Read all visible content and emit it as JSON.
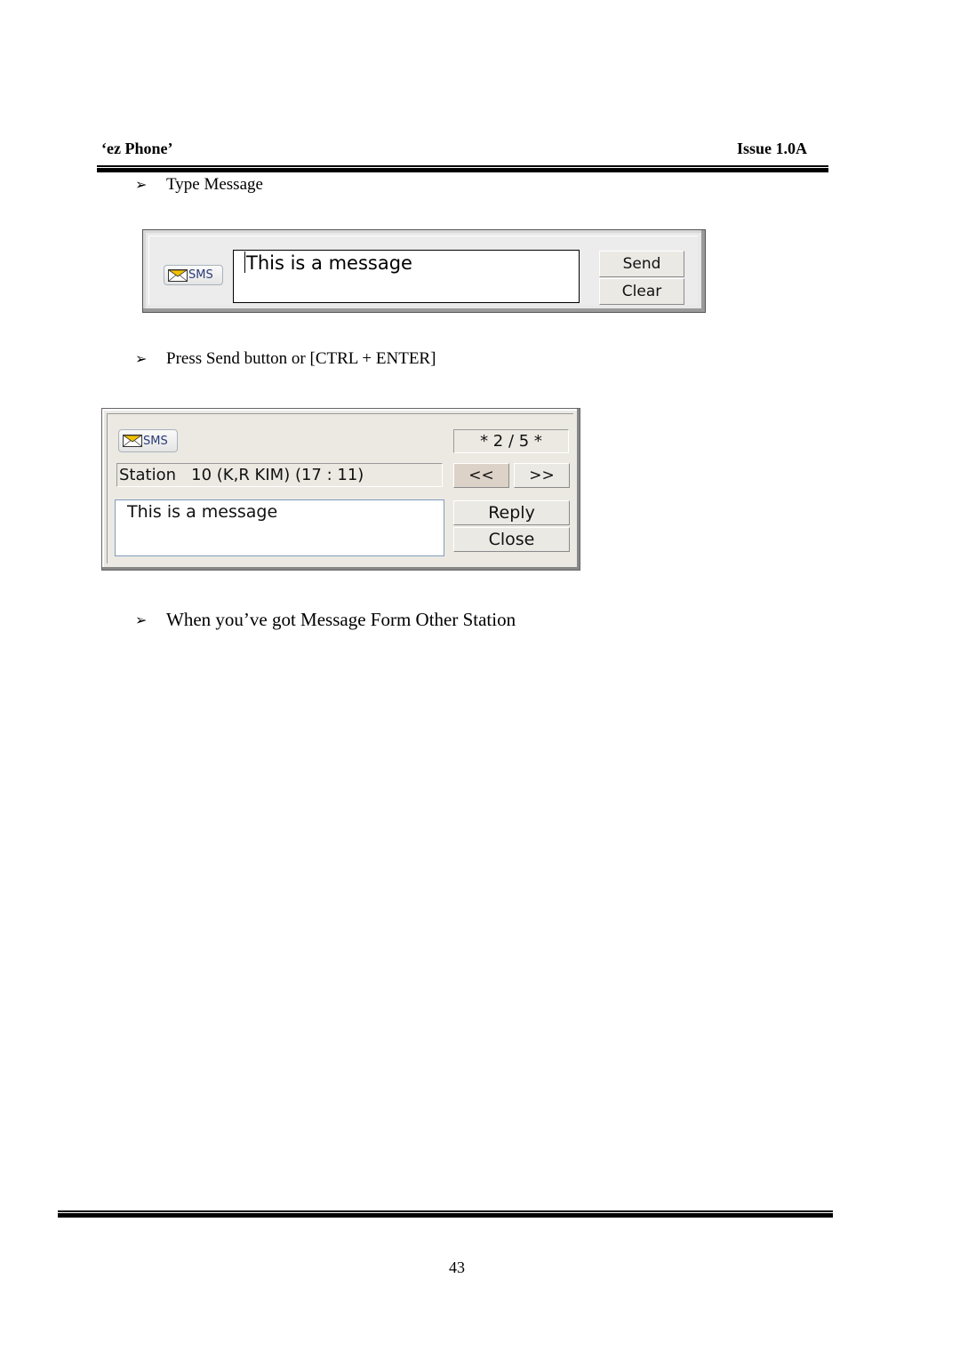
{
  "header": {
    "doc_title": "‘ez Phone’",
    "issue": "Issue 1.0A"
  },
  "bullets": [
    {
      "icon": "arrow-bullet-icon",
      "glyph": "➢",
      "text": "Type Message"
    },
    {
      "icon": "arrow-bullet-icon",
      "glyph": "➢",
      "text": "Press Send button or [CTRL + ENTER]"
    },
    {
      "icon": "arrow-bullet-icon",
      "glyph": "➢",
      "text": "When you’ve got Message Form Other Station"
    }
  ],
  "compose_widget": {
    "sms_label": "SMS",
    "message_value": "This is a message",
    "send_label": "Send",
    "clear_label": "Clear"
  },
  "received_widget": {
    "sms_label": "SMS",
    "counter": "* 2 / 5 *",
    "current_index": 2,
    "total": 5,
    "station_info": "Station   10 (K,R KIM) (17 : 11)",
    "prev_label": "<<",
    "next_label": ">>",
    "message_value": "This is a message",
    "reply_label": "Reply",
    "close_label": "Close"
  },
  "colors": {
    "envelope_flap": "#f2c200",
    "sms_text": "#2a3a78",
    "window_bg": "#ebe9e4",
    "input_border_blue": "#7f9db9"
  },
  "footer": {
    "page_number": "43"
  }
}
